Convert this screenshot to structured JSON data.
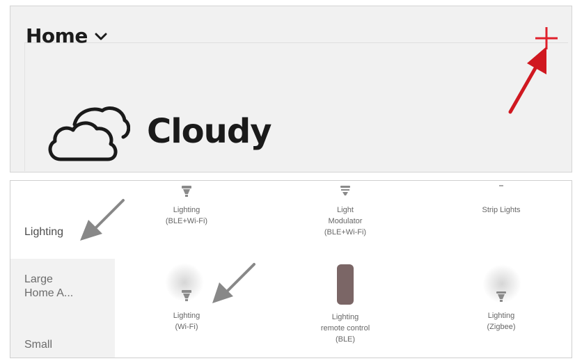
{
  "header": {
    "home_label": "Home",
    "add_icon": "plus-icon",
    "chevron_icon": "chevron-down-icon",
    "accent_color": "#e0202b"
  },
  "weather": {
    "icon": "cloud-icon",
    "condition": "Cloudy"
  },
  "categories": [
    {
      "label": "Lighting",
      "active": true
    },
    {
      "label": "Large\nHome A...",
      "active": false
    },
    {
      "label": "Small",
      "active": false
    }
  ],
  "devices": [
    {
      "label": "Lighting\n(BLE+Wi-Fi)",
      "icon": "bulb-icon"
    },
    {
      "label": "Light\nModulator\n(BLE+Wi-Fi)",
      "icon": "bulb-icon"
    },
    {
      "label": "Strip Lights",
      "icon": "strip-light-icon"
    },
    {
      "label": "Lighting\n(Wi-Fi)",
      "icon": "bulb-icon"
    },
    {
      "label": "Lighting\nremote control\n(BLE)",
      "icon": "remote-control-icon"
    },
    {
      "label": "Lighting\n(Zigbee)",
      "icon": "bulb-icon"
    }
  ]
}
